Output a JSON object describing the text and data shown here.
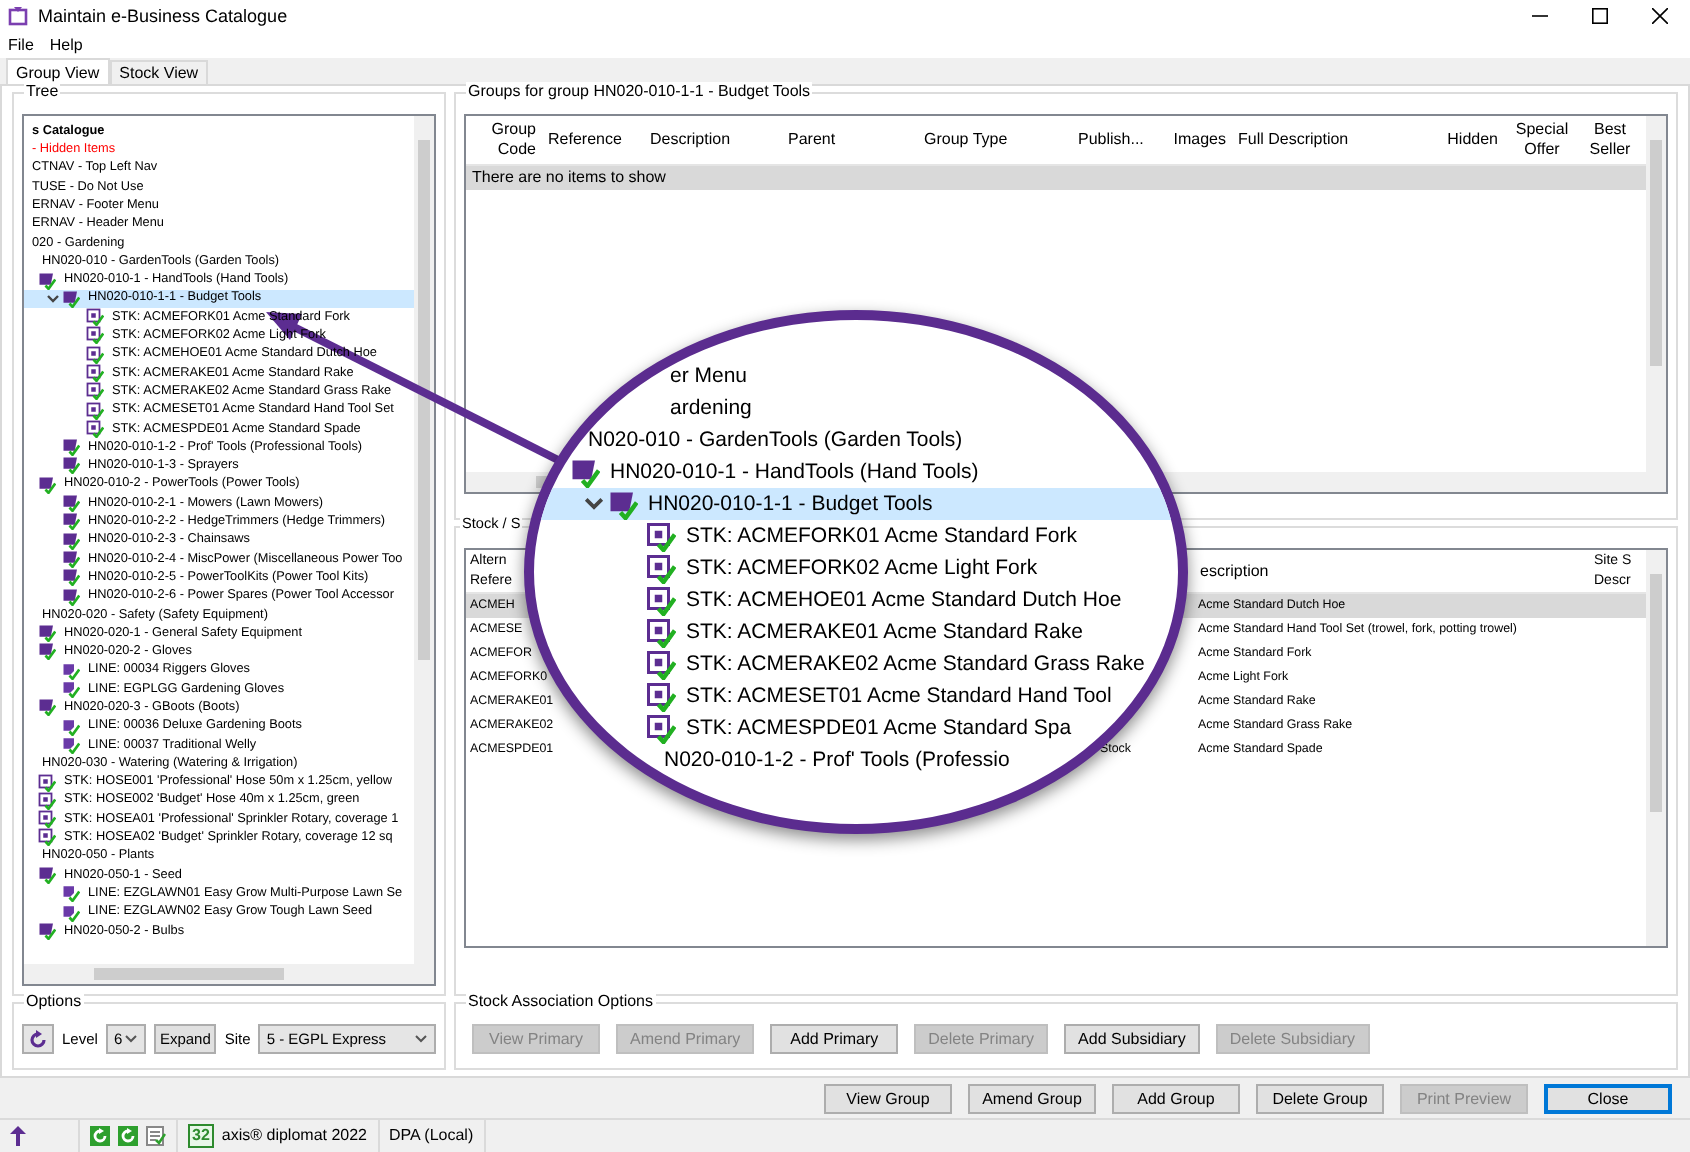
{
  "window": {
    "title": "Maintain e-Business Catalogue"
  },
  "menu": [
    "File",
    "Help"
  ],
  "tabs": [
    {
      "label": "Group View",
      "selected": true
    },
    {
      "label": "Stock View",
      "selected": false
    }
  ],
  "tree": {
    "label": "Tree",
    "nodes": [
      {
        "text": "s Catalogue",
        "kind": "root",
        "selected": false,
        "children": [
          {
            "text": "- Hidden Items",
            "kind": "hidden",
            "selected": false
          },
          {
            "text": "CTNAV - Top Left Nav",
            "kind": "plain",
            "selected": false
          },
          {
            "text": "TUSE - Do Not Use",
            "kind": "plain",
            "selected": false
          },
          {
            "text": "ERNAV - Footer Menu",
            "kind": "plain",
            "selected": false
          },
          {
            "text": "ERNAV - Header Menu",
            "kind": "plain",
            "selected": false
          },
          {
            "text": "020 - Gardening",
            "kind": "plain",
            "selected": false,
            "children": [
              {
                "text": "HN020-010 - GardenTools (Garden Tools)",
                "kind": "plain",
                "selected": false,
                "children": [
                  {
                    "text": "HN020-010-1 - HandTools (Hand Tools)",
                    "kind": "group",
                    "selected": false,
                    "children": [
                      {
                        "text": "HN020-010-1-1 - Budget Tools",
                        "kind": "group",
                        "selected": true,
                        "children": [
                          {
                            "text": "STK: ACMEFORK01 Acme Standard Fork",
                            "kind": "stock",
                            "selected": false
                          },
                          {
                            "text": "STK: ACMEFORK02 Acme Light Fork",
                            "kind": "stock",
                            "selected": false
                          },
                          {
                            "text": "STK: ACMEHOE01 Acme Standard Dutch Hoe",
                            "kind": "stock",
                            "selected": false
                          },
                          {
                            "text": "STK: ACMERAKE01 Acme Standard Rake",
                            "kind": "stock",
                            "selected": false
                          },
                          {
                            "text": "STK: ACMERAKE02 Acme Standard Grass Rake",
                            "kind": "stock",
                            "selected": false
                          },
                          {
                            "text": "STK: ACMESET01 Acme Standard Hand Tool Set",
                            "kind": "stock",
                            "selected": false
                          },
                          {
                            "text": "STK: ACMESPDE01 Acme Standard Spade",
                            "kind": "stock",
                            "selected": false
                          }
                        ]
                      },
                      {
                        "text": "HN020-010-1-2 - Prof' Tools (Professional Tools)",
                        "kind": "group",
                        "selected": false
                      },
                      {
                        "text": "HN020-010-1-3 - Sprayers",
                        "kind": "group",
                        "selected": false
                      }
                    ]
                  },
                  {
                    "text": "HN020-010-2 - PowerTools (Power Tools)",
                    "kind": "group",
                    "selected": false,
                    "children": [
                      {
                        "text": "HN020-010-2-1 - Mowers (Lawn Mowers)",
                        "kind": "group",
                        "selected": false
                      },
                      {
                        "text": "HN020-010-2-2 - HedgeTrimmers (Hedge Trimmers)",
                        "kind": "group",
                        "selected": false
                      },
                      {
                        "text": "HN020-010-2-3 - Chainsaws",
                        "kind": "group",
                        "selected": false
                      },
                      {
                        "text": "HN020-010-2-4 - MiscPower (Miscellaneous Power Too",
                        "kind": "group",
                        "selected": false
                      },
                      {
                        "text": "HN020-010-2-5 - PowerToolKits (Power Tool Kits)",
                        "kind": "group",
                        "selected": false
                      },
                      {
                        "text": "HN020-010-2-6 - Power Spares (Power Tool Accessor",
                        "kind": "group",
                        "selected": false
                      }
                    ]
                  }
                ]
              },
              {
                "text": "HN020-020 - Safety (Safety Equipment)",
                "kind": "plain",
                "selected": false,
                "children": [
                  {
                    "text": "HN020-020-1 - General Safety Equipment",
                    "kind": "group",
                    "selected": false
                  },
                  {
                    "text": "HN020-020-2 - Gloves",
                    "kind": "group",
                    "selected": false,
                    "children": [
                      {
                        "text": "LINE: 00034 Riggers Gloves",
                        "kind": "line",
                        "selected": false
                      },
                      {
                        "text": "LINE: EGPLGG Gardening Gloves",
                        "kind": "line",
                        "selected": false
                      }
                    ]
                  },
                  {
                    "text": "HN020-020-3 - GBoots (Boots)",
                    "kind": "group",
                    "selected": false,
                    "children": [
                      {
                        "text": "LINE: 00036 Deluxe Gardening Boots",
                        "kind": "line",
                        "selected": false
                      },
                      {
                        "text": "LINE: 00037 Traditional Welly",
                        "kind": "line",
                        "selected": false
                      }
                    ]
                  }
                ]
              },
              {
                "text": "HN020-030 - Watering (Watering & Irrigation)",
                "kind": "plain",
                "selected": false,
                "children": [
                  {
                    "text": "STK: HOSE001 'Professional' Hose 50m x 1.25cm, yellow",
                    "kind": "stock",
                    "selected": false
                  },
                  {
                    "text": "STK: HOSE002 'Budget' Hose 40m x 1.25cm, green",
                    "kind": "stock",
                    "selected": false
                  },
                  {
                    "text": "STK: HOSEA01 'Professional' Sprinkler Rotary, coverage 1",
                    "kind": "stock",
                    "selected": false
                  },
                  {
                    "text": "STK: HOSEA02 'Budget' Sprinkler Rotary, coverage 12 sq",
                    "kind": "stock",
                    "selected": false
                  }
                ]
              },
              {
                "text": "HN020-050 - Plants",
                "kind": "plain",
                "selected": false,
                "children": [
                  {
                    "text": "HN020-050-1 - Seed",
                    "kind": "group",
                    "selected": false,
                    "children": [
                      {
                        "text": "LINE: EZGLAWN01 Easy Grow Multi-Purpose Lawn Se",
                        "kind": "line",
                        "selected": false
                      },
                      {
                        "text": "LINE: EZGLAWN02 Easy Grow Tough Lawn Seed",
                        "kind": "line",
                        "selected": false
                      }
                    ]
                  },
                  {
                    "text": "HN020-050-2 - Bulbs",
                    "kind": "group",
                    "selected": false
                  }
                ]
              }
            ]
          }
        ]
      }
    ]
  },
  "options": {
    "label": "Options",
    "level_label": "Level",
    "level": "6",
    "expand": "Expand",
    "site_label": "Site",
    "site": "5 - EGPL Express"
  },
  "groups": {
    "label": "Groups for group HN020-010-1-1 - Budget Tools",
    "columns": [
      "Group Code",
      "Reference",
      "Description",
      "Parent",
      "Group Type",
      "Publish...",
      "Images",
      "Full Description",
      "Hidden",
      "Special Offer",
      "Best Seller"
    ],
    "empty_message": "There are no items to show"
  },
  "stock": {
    "label": "Stock / S",
    "columns": [
      "Altern Refere",
      "escription",
      "Site S Descr"
    ],
    "rows": [
      {
        "alt_ref": "ACMEH",
        "description": "Acme Standard Dutch Hoe",
        "selected": true
      },
      {
        "alt_ref": "ACMESE",
        "description": "Acme Standard Hand Tool Set (trowel, fork, potting trowel)",
        "selected": false
      },
      {
        "alt_ref": "ACMEFOR",
        "description": "Acme Standard Fork",
        "selected": false
      },
      {
        "alt_ref": "ACMEFORK0",
        "description": "Acme Light Fork",
        "selected": false
      },
      {
        "alt_ref": "ACMERAKE01",
        "description": "Acme Standard Rake",
        "selected": false
      },
      {
        "alt_ref": "ACMERAKE02",
        "description": "Acme Standard Grass Rake",
        "selected": false
      },
      {
        "alt_ref": "ACMESPDE01",
        "type": "Stock",
        "description": "Acme Standard Spade",
        "selected": false
      }
    ]
  },
  "association": {
    "label": "Stock Association Options",
    "buttons": [
      {
        "label": "View Primary",
        "disabled": true
      },
      {
        "label": "Amend Primary",
        "disabled": true
      },
      {
        "label": "Add Primary",
        "disabled": false
      },
      {
        "label": "Delete Primary",
        "disabled": true
      },
      {
        "label": "Add Subsidiary",
        "disabled": false
      },
      {
        "label": "Delete Subsidiary",
        "disabled": true
      }
    ]
  },
  "buttons": [
    {
      "label": "View Group",
      "disabled": false,
      "default": false
    },
    {
      "label": "Amend Group",
      "disabled": false,
      "default": false
    },
    {
      "label": "Add Group",
      "disabled": false,
      "default": false
    },
    {
      "label": "Delete Group",
      "disabled": false,
      "default": false
    },
    {
      "label": "Print Preview",
      "disabled": true,
      "default": false
    },
    {
      "label": "Close",
      "disabled": false,
      "default": true
    }
  ],
  "magnifier": {
    "nodes": [
      {
        "text": "er Menu",
        "kind": "plain",
        "selected": false
      },
      {
        "text": "ardening",
        "kind": "plain",
        "selected": false,
        "children": [
          {
            "text": "N020-010 - GardenTools (Garden Tools)",
            "kind": "plain",
            "selected": false,
            "children": [
              {
                "text": "HN020-010-1 - HandTools (Hand Tools)",
                "kind": "group",
                "selected": false,
                "children": [
                  {
                    "text": "HN020-010-1-1 - Budget Tools",
                    "kind": "group",
                    "selected": true,
                    "children": [
                      {
                        "text": "STK: ACMEFORK01 Acme Standard Fork",
                        "kind": "stock",
                        "selected": false
                      },
                      {
                        "text": "STK: ACMEFORK02 Acme Light Fork",
                        "kind": "stock",
                        "selected": false
                      },
                      {
                        "text": "STK: ACMEHOE01 Acme Standard Dutch Hoe",
                        "kind": "stock",
                        "selected": false
                      },
                      {
                        "text": "STK: ACMERAKE01 Acme Standard Rake",
                        "kind": "stock",
                        "selected": false
                      },
                      {
                        "text": "STK: ACMERAKE02 Acme Standard Grass Rake",
                        "kind": "stock",
                        "selected": false
                      },
                      {
                        "text": "STK: ACMESET01 Acme Standard Hand Tool",
                        "kind": "stock",
                        "selected": false
                      },
                      {
                        "text": "STK: ACMESPDE01 Acme Standard Spa",
                        "kind": "stock",
                        "selected": false
                      }
                    ]
                  },
                  {
                    "text": "N020-010-1-2 - Prof' Tools (Professio",
                    "kind": "plain",
                    "selected": false
                  }
                ]
              }
            ]
          }
        ]
      }
    ]
  },
  "status_bar": {
    "badge": "32",
    "product": "axis® diplomat 2022",
    "connection": "DPA (Local)"
  }
}
